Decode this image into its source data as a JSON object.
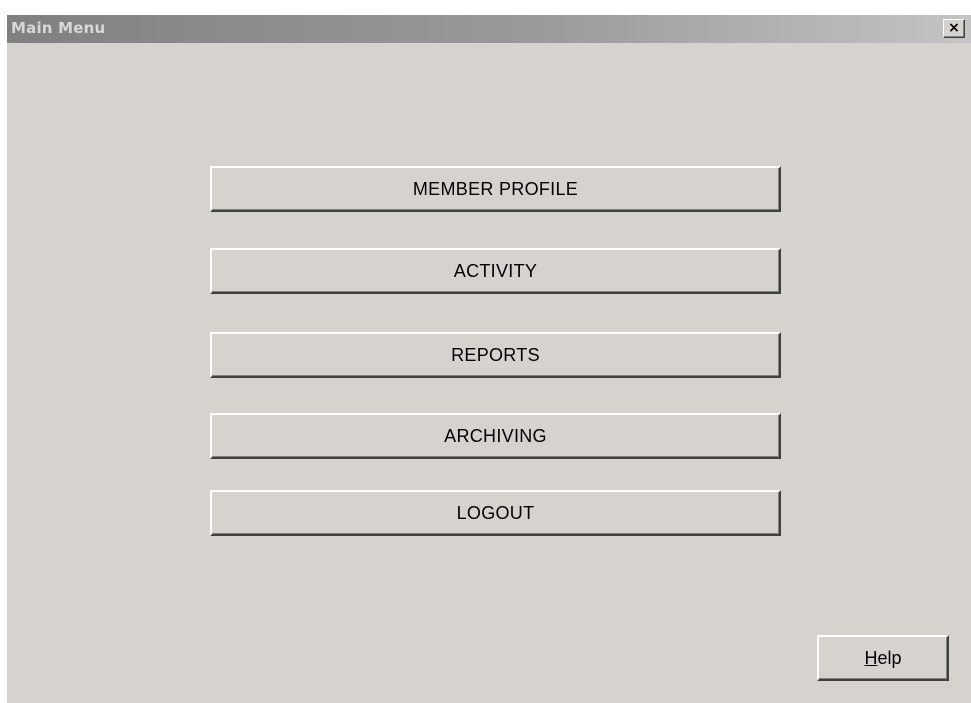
{
  "window": {
    "title": "Main Menu",
    "close_glyph": "×"
  },
  "menu": {
    "buttons": [
      {
        "label": "MEMBER PROFILE"
      },
      {
        "label": "ACTIVITY"
      },
      {
        "label": "REPORTS"
      },
      {
        "label": "ARCHIVING"
      },
      {
        "label": "LOGOUT"
      }
    ]
  },
  "help": {
    "mnemonic": "H",
    "rest": "elp"
  }
}
